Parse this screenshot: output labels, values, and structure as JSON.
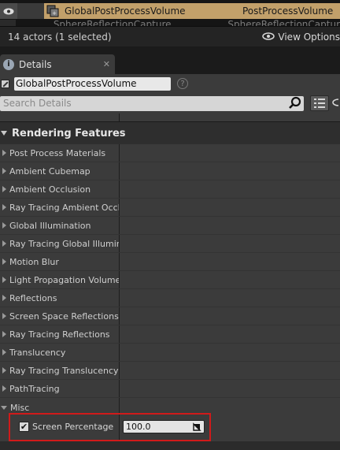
{
  "outliner": {
    "selected_row": {
      "name": "GlobalPostProcessVolume",
      "type": "PostProcessVolume"
    },
    "next_row": {
      "name": "SphereReflectionCapture",
      "type": "SphereReflectionCaptur"
    },
    "status": "14 actors (1 selected)",
    "view_options_label": "View Options"
  },
  "details": {
    "tab_label": "Details",
    "tab_close": "✕",
    "actor_name": "GlobalPostProcessVolume",
    "search_placeholder": "Search Details",
    "category_title": "Rendering Features",
    "properties": [
      "Post Process Materials",
      "Ambient Cubemap",
      "Ambient Occlusion",
      "Ray Tracing Ambient Occlusion",
      "Global Illumination",
      "Ray Tracing Global Illumination",
      "Motion Blur",
      "Light Propagation Volume",
      "Reflections",
      "Screen Space Reflections",
      "Ray Tracing Reflections",
      "Translucency",
      "Ray Tracing Translucency",
      "PathTracing"
    ],
    "misc_label": "Misc",
    "screen_percentage": {
      "label": "Screen Percentage",
      "value": "100.0",
      "checked": true
    }
  },
  "colors": {
    "selection": "#c2a06a",
    "panel": "#3b3b3b",
    "highlight_box": "#d01a1a"
  },
  "icons": [
    "eye-icon",
    "actor-icon",
    "details-tab-icon",
    "close-icon",
    "edit-name-icon",
    "help-icon",
    "search-icon",
    "grid-view-icon",
    "reset-to-default-icon",
    "checkbox-icon"
  ]
}
